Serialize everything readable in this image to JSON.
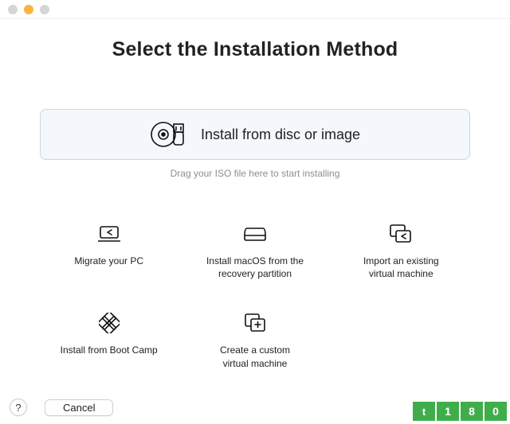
{
  "window": {
    "title": "Select the Installation Method"
  },
  "primary": {
    "label": "Install from disc or image",
    "hint": "Drag your ISO file here to start installing"
  },
  "options": [
    {
      "label": "Migrate your PC"
    },
    {
      "label": "Install macOS from the\nrecovery partition"
    },
    {
      "label": "Import an existing\nvirtual machine"
    },
    {
      "label": "Install from Boot Camp"
    },
    {
      "label": "Create a custom\nvirtual machine"
    }
  ],
  "footer": {
    "help": "?",
    "cancel": "Cancel"
  },
  "watermark": [
    "t",
    "1",
    "8",
    "0"
  ]
}
